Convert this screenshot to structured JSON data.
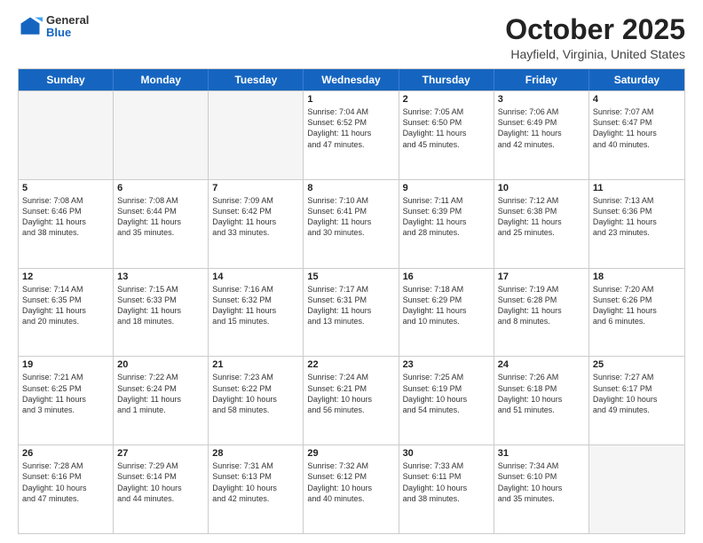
{
  "header": {
    "logo_general": "General",
    "logo_blue": "Blue",
    "month": "October 2025",
    "location": "Hayfield, Virginia, United States"
  },
  "weekdays": [
    "Sunday",
    "Monday",
    "Tuesday",
    "Wednesday",
    "Thursday",
    "Friday",
    "Saturday"
  ],
  "rows": [
    [
      {
        "day": "",
        "empty": true
      },
      {
        "day": "",
        "empty": true
      },
      {
        "day": "",
        "empty": true
      },
      {
        "day": "1",
        "lines": [
          "Sunrise: 7:04 AM",
          "Sunset: 6:52 PM",
          "Daylight: 11 hours",
          "and 47 minutes."
        ]
      },
      {
        "day": "2",
        "lines": [
          "Sunrise: 7:05 AM",
          "Sunset: 6:50 PM",
          "Daylight: 11 hours",
          "and 45 minutes."
        ]
      },
      {
        "day": "3",
        "lines": [
          "Sunrise: 7:06 AM",
          "Sunset: 6:49 PM",
          "Daylight: 11 hours",
          "and 42 minutes."
        ]
      },
      {
        "day": "4",
        "lines": [
          "Sunrise: 7:07 AM",
          "Sunset: 6:47 PM",
          "Daylight: 11 hours",
          "and 40 minutes."
        ]
      }
    ],
    [
      {
        "day": "5",
        "lines": [
          "Sunrise: 7:08 AM",
          "Sunset: 6:46 PM",
          "Daylight: 11 hours",
          "and 38 minutes."
        ]
      },
      {
        "day": "6",
        "lines": [
          "Sunrise: 7:08 AM",
          "Sunset: 6:44 PM",
          "Daylight: 11 hours",
          "and 35 minutes."
        ]
      },
      {
        "day": "7",
        "lines": [
          "Sunrise: 7:09 AM",
          "Sunset: 6:42 PM",
          "Daylight: 11 hours",
          "and 33 minutes."
        ]
      },
      {
        "day": "8",
        "lines": [
          "Sunrise: 7:10 AM",
          "Sunset: 6:41 PM",
          "Daylight: 11 hours",
          "and 30 minutes."
        ]
      },
      {
        "day": "9",
        "lines": [
          "Sunrise: 7:11 AM",
          "Sunset: 6:39 PM",
          "Daylight: 11 hours",
          "and 28 minutes."
        ]
      },
      {
        "day": "10",
        "lines": [
          "Sunrise: 7:12 AM",
          "Sunset: 6:38 PM",
          "Daylight: 11 hours",
          "and 25 minutes."
        ]
      },
      {
        "day": "11",
        "lines": [
          "Sunrise: 7:13 AM",
          "Sunset: 6:36 PM",
          "Daylight: 11 hours",
          "and 23 minutes."
        ]
      }
    ],
    [
      {
        "day": "12",
        "lines": [
          "Sunrise: 7:14 AM",
          "Sunset: 6:35 PM",
          "Daylight: 11 hours",
          "and 20 minutes."
        ]
      },
      {
        "day": "13",
        "lines": [
          "Sunrise: 7:15 AM",
          "Sunset: 6:33 PM",
          "Daylight: 11 hours",
          "and 18 minutes."
        ]
      },
      {
        "day": "14",
        "lines": [
          "Sunrise: 7:16 AM",
          "Sunset: 6:32 PM",
          "Daylight: 11 hours",
          "and 15 minutes."
        ]
      },
      {
        "day": "15",
        "lines": [
          "Sunrise: 7:17 AM",
          "Sunset: 6:31 PM",
          "Daylight: 11 hours",
          "and 13 minutes."
        ]
      },
      {
        "day": "16",
        "lines": [
          "Sunrise: 7:18 AM",
          "Sunset: 6:29 PM",
          "Daylight: 11 hours",
          "and 10 minutes."
        ]
      },
      {
        "day": "17",
        "lines": [
          "Sunrise: 7:19 AM",
          "Sunset: 6:28 PM",
          "Daylight: 11 hours",
          "and 8 minutes."
        ]
      },
      {
        "day": "18",
        "lines": [
          "Sunrise: 7:20 AM",
          "Sunset: 6:26 PM",
          "Daylight: 11 hours",
          "and 6 minutes."
        ]
      }
    ],
    [
      {
        "day": "19",
        "lines": [
          "Sunrise: 7:21 AM",
          "Sunset: 6:25 PM",
          "Daylight: 11 hours",
          "and 3 minutes."
        ]
      },
      {
        "day": "20",
        "lines": [
          "Sunrise: 7:22 AM",
          "Sunset: 6:24 PM",
          "Daylight: 11 hours",
          "and 1 minute."
        ]
      },
      {
        "day": "21",
        "lines": [
          "Sunrise: 7:23 AM",
          "Sunset: 6:22 PM",
          "Daylight: 10 hours",
          "and 58 minutes."
        ]
      },
      {
        "day": "22",
        "lines": [
          "Sunrise: 7:24 AM",
          "Sunset: 6:21 PM",
          "Daylight: 10 hours",
          "and 56 minutes."
        ]
      },
      {
        "day": "23",
        "lines": [
          "Sunrise: 7:25 AM",
          "Sunset: 6:19 PM",
          "Daylight: 10 hours",
          "and 54 minutes."
        ]
      },
      {
        "day": "24",
        "lines": [
          "Sunrise: 7:26 AM",
          "Sunset: 6:18 PM",
          "Daylight: 10 hours",
          "and 51 minutes."
        ]
      },
      {
        "day": "25",
        "lines": [
          "Sunrise: 7:27 AM",
          "Sunset: 6:17 PM",
          "Daylight: 10 hours",
          "and 49 minutes."
        ]
      }
    ],
    [
      {
        "day": "26",
        "lines": [
          "Sunrise: 7:28 AM",
          "Sunset: 6:16 PM",
          "Daylight: 10 hours",
          "and 47 minutes."
        ]
      },
      {
        "day": "27",
        "lines": [
          "Sunrise: 7:29 AM",
          "Sunset: 6:14 PM",
          "Daylight: 10 hours",
          "and 44 minutes."
        ]
      },
      {
        "day": "28",
        "lines": [
          "Sunrise: 7:31 AM",
          "Sunset: 6:13 PM",
          "Daylight: 10 hours",
          "and 42 minutes."
        ]
      },
      {
        "day": "29",
        "lines": [
          "Sunrise: 7:32 AM",
          "Sunset: 6:12 PM",
          "Daylight: 10 hours",
          "and 40 minutes."
        ]
      },
      {
        "day": "30",
        "lines": [
          "Sunrise: 7:33 AM",
          "Sunset: 6:11 PM",
          "Daylight: 10 hours",
          "and 38 minutes."
        ]
      },
      {
        "day": "31",
        "lines": [
          "Sunrise: 7:34 AM",
          "Sunset: 6:10 PM",
          "Daylight: 10 hours",
          "and 35 minutes."
        ]
      },
      {
        "day": "",
        "empty": true
      }
    ]
  ]
}
